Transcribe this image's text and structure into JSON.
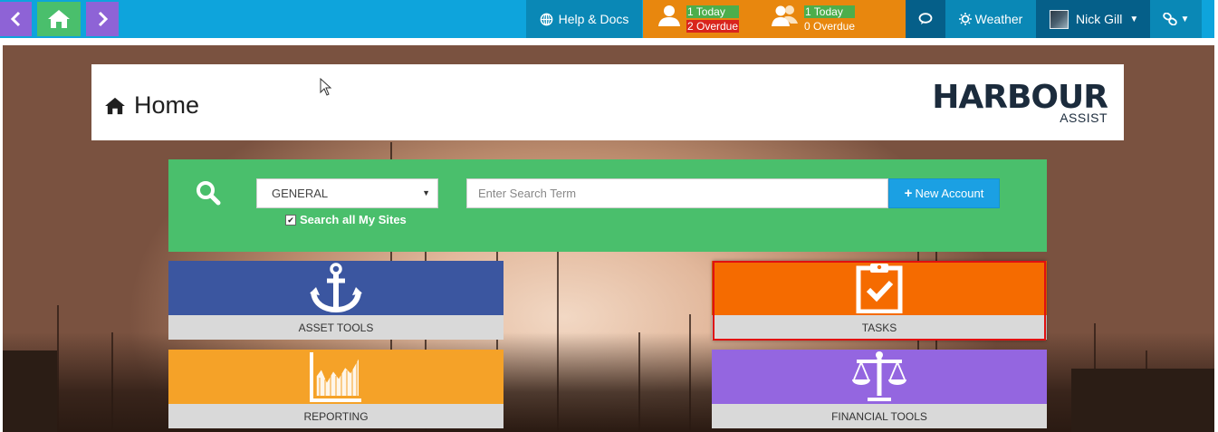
{
  "topbar": {
    "help_label": "Help & Docs",
    "my_tasks": {
      "today": "1 Today",
      "overdue": "2 Overdue"
    },
    "team_tasks": {
      "today": "1 Today",
      "overdue": "0 Overdue"
    },
    "weather_label": "Weather",
    "user_name": "Nick Gill"
  },
  "header": {
    "title": "Home",
    "logo_text": "HARBOUR",
    "logo_sub": "ASSIST"
  },
  "search": {
    "category_selected": "GENERAL",
    "search_all_label": "Search all My Sites",
    "search_all_checked": true,
    "placeholder": "Enter Search Term",
    "new_account_label": "New Account"
  },
  "tiles": [
    {
      "label": "ASSET TOOLS",
      "icon": "anchor-icon",
      "color": "#3b56a0"
    },
    {
      "label": "TASKS",
      "icon": "clipboard-check-icon",
      "color": "#f56b00"
    },
    {
      "label": "REPORTING",
      "icon": "area-chart-icon",
      "color": "#f5a228"
    },
    {
      "label": "FINANCIAL TOOLS",
      "icon": "scales-icon",
      "color": "#9466e0"
    }
  ],
  "colors": {
    "topbar": "#0ea4dc",
    "tasks_bar": "#e8870e",
    "search_panel": "#4abf6c",
    "accent_button": "#1ba0e3"
  }
}
